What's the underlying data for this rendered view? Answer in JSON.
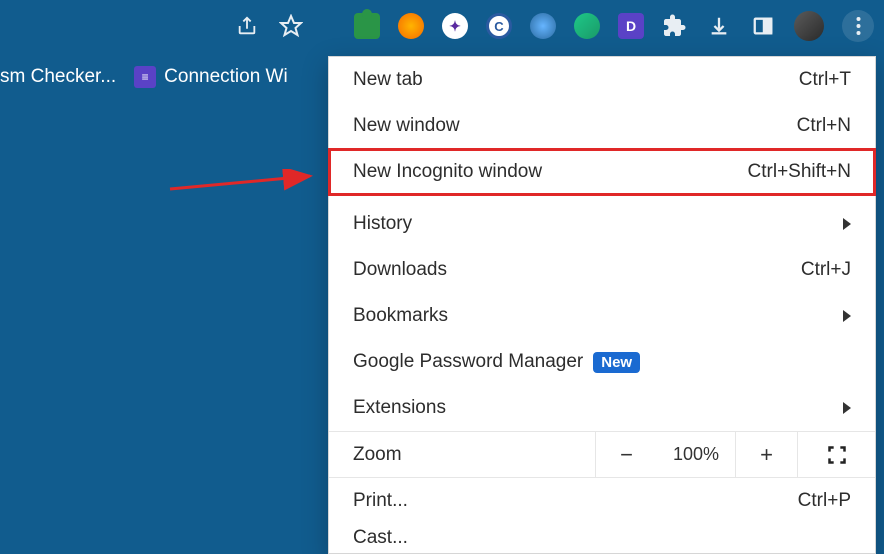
{
  "toolbar": {
    "icons": [
      "share",
      "star"
    ],
    "extensions": [
      "puzzle",
      "sun",
      "compass",
      "C",
      "swirl",
      "greencircle",
      "D",
      "puzzle-outline"
    ],
    "actions": [
      "download",
      "panel"
    ]
  },
  "bookmarks": {
    "items": [
      "sm Checker...",
      "Connection Wi"
    ]
  },
  "menu": {
    "new_tab": {
      "label": "New tab",
      "shortcut": "Ctrl+T"
    },
    "new_window": {
      "label": "New window",
      "shortcut": "Ctrl+N"
    },
    "new_incognito": {
      "label": "New Incognito window",
      "shortcut": "Ctrl+Shift+N"
    },
    "history": {
      "label": "History"
    },
    "downloads": {
      "label": "Downloads",
      "shortcut": "Ctrl+J"
    },
    "bookmarks_menu": {
      "label": "Bookmarks"
    },
    "password_manager": {
      "label": "Google Password Manager",
      "badge": "New"
    },
    "extensions": {
      "label": "Extensions"
    },
    "zoom": {
      "label": "Zoom",
      "value": "100%",
      "minus": "−",
      "plus": "+"
    },
    "print": {
      "label": "Print...",
      "shortcut": "Ctrl+P"
    },
    "cast": {
      "label": "Cast..."
    }
  }
}
